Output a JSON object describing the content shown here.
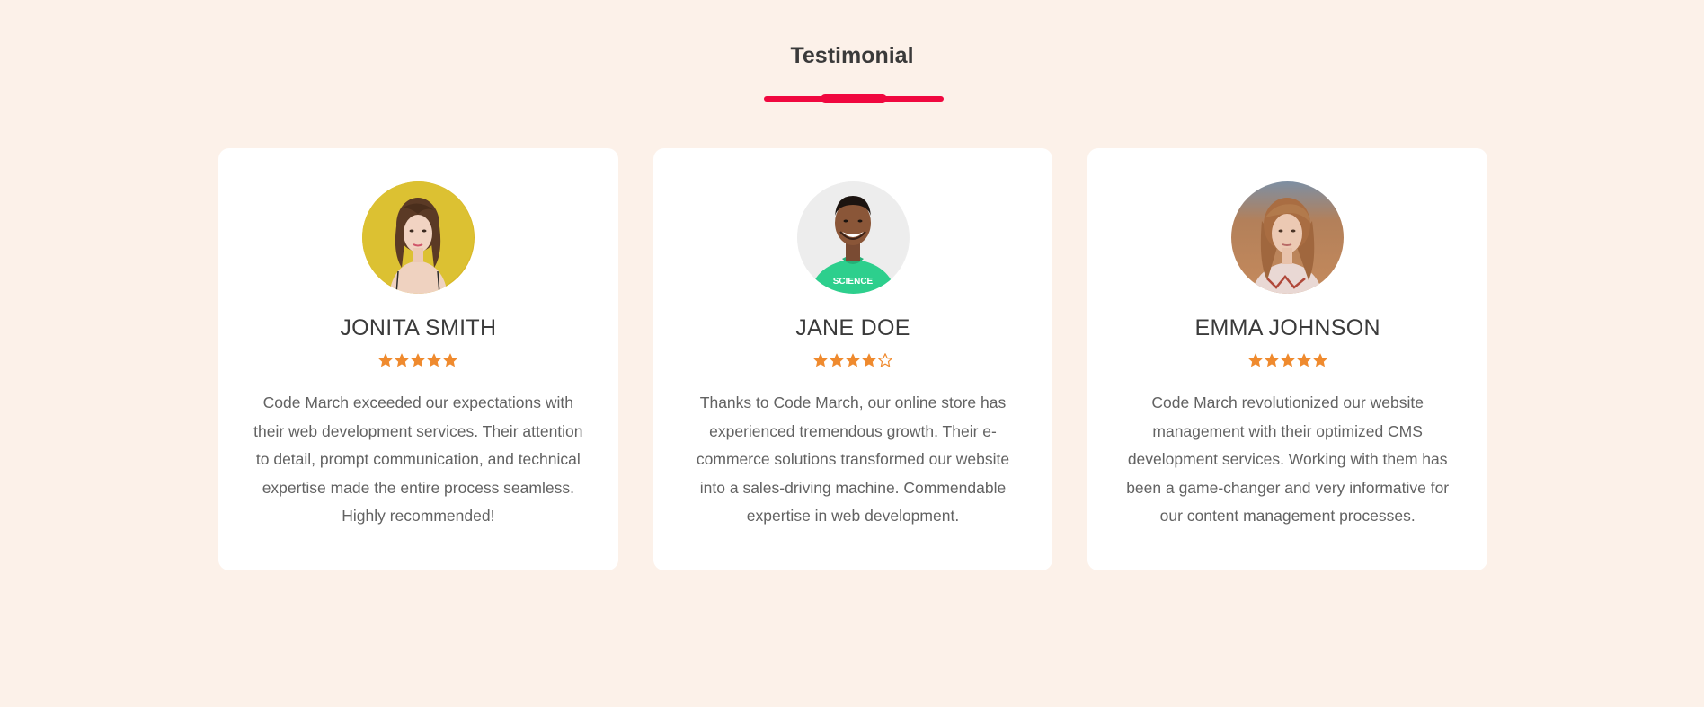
{
  "section": {
    "title": "Testimonial"
  },
  "colors": {
    "background": "#fcf1e9",
    "accent": "#f0083f",
    "star": "#ef8a2e",
    "card": "#ffffff"
  },
  "testimonials": [
    {
      "name": "JONITA SMITH",
      "rating": 5,
      "max_rating": 5,
      "avatar_icon": "woman-portrait-yellow-background",
      "text": "Code March exceeded our expectations with their web development services. Their attention to detail, prompt communication, and technical expertise made the entire process seamless. Highly recommended!"
    },
    {
      "name": "JANE DOE",
      "rating": 4,
      "max_rating": 5,
      "avatar_icon": "man-portrait-green-shirt",
      "text": "Thanks to Code March, our online store has experienced tremendous growth. Their e-commerce solutions transformed our website into a sales-driving machine. Commendable expertise in web development."
    },
    {
      "name": "EMMA JOHNSON",
      "rating": 5,
      "max_rating": 5,
      "avatar_icon": "woman-portrait-brown-background",
      "text": "Code March revolutionized our website management with their optimized CMS development services. Working with them has been a game-changer and very informative for our content management processes."
    }
  ]
}
